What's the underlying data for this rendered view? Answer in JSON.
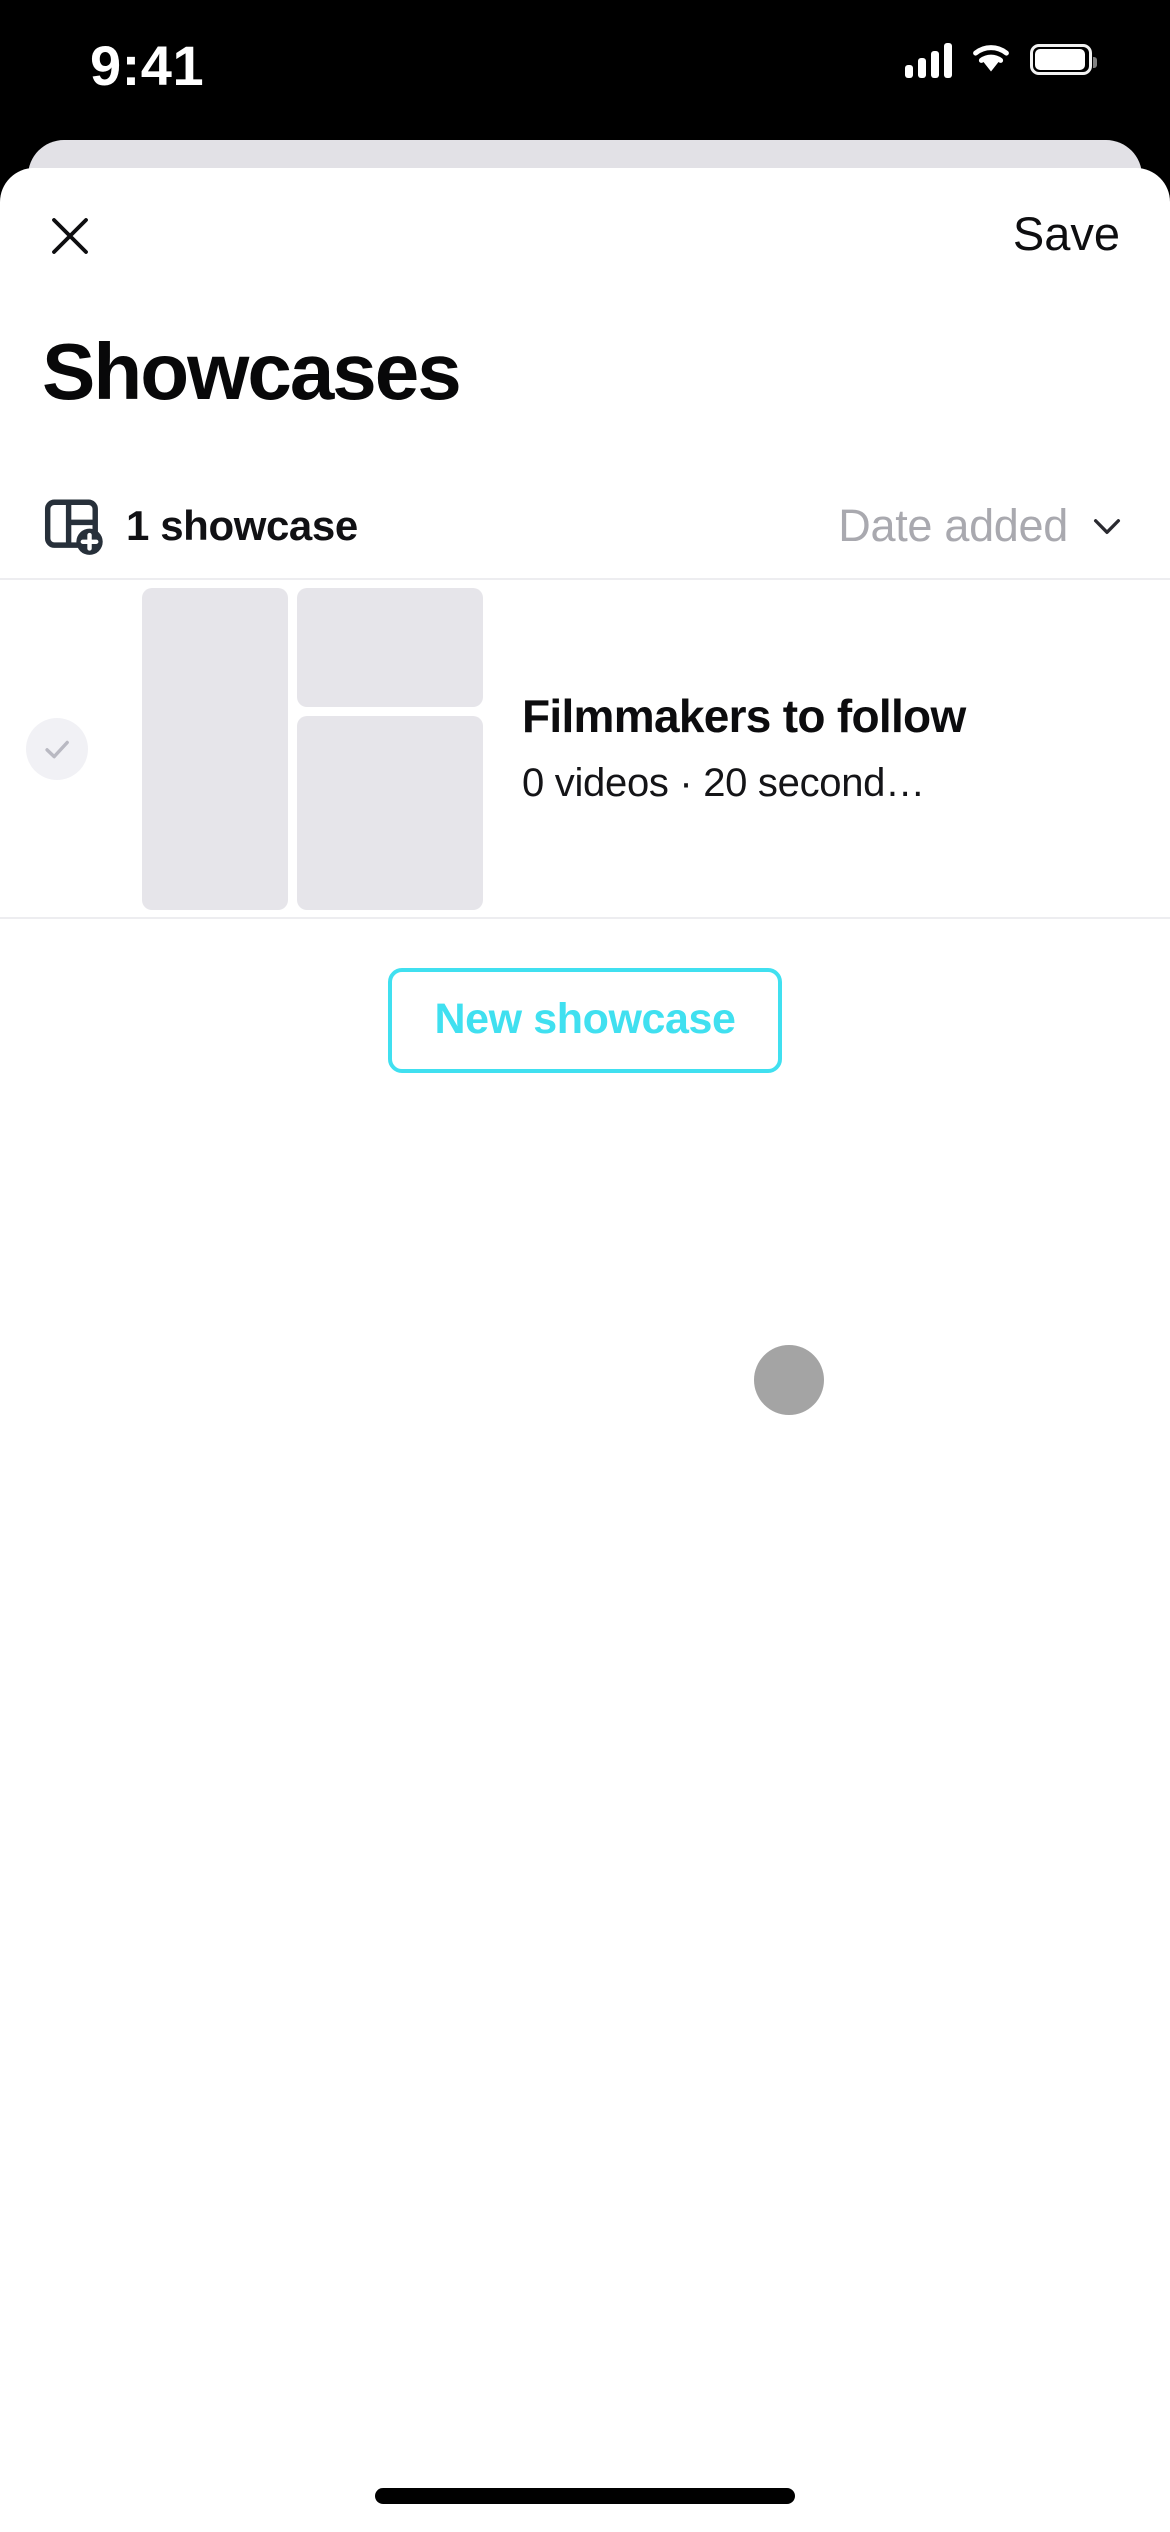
{
  "status_bar": {
    "time": "9:41",
    "cellular_icon": "signal-bars-icon",
    "wifi_icon": "wifi-icon",
    "battery_icon": "battery-icon"
  },
  "sheet": {
    "nav": {
      "close_icon": "close-icon",
      "save_label": "Save"
    },
    "title": "Showcases",
    "toolbar": {
      "layout_icon": "showcase-layout-add-icon",
      "count_label": "1 showcase",
      "sort_label": "Date added",
      "sort_chevron_icon": "chevron-down-icon"
    },
    "list": {
      "rows": [
        {
          "check_icon": "checkmark-icon",
          "thumbnail": "showcase-thumbnail-placeholder",
          "title": "Filmmakers to follow",
          "subtitle": "0 videos · 20 second…"
        }
      ]
    },
    "new_showcase_label": "New showcase"
  },
  "colors": {
    "accent_cyan": "#40E0F0",
    "sheet_background": "#FFFFFF",
    "peek_card": "#E2E1E6",
    "thumbnail_placeholder": "#E6E5EA",
    "muted_text": "#A9A9AF",
    "divider": "#EDEDF0",
    "check_circle": "#F1F1F5",
    "status_bar_background": "#000000"
  }
}
